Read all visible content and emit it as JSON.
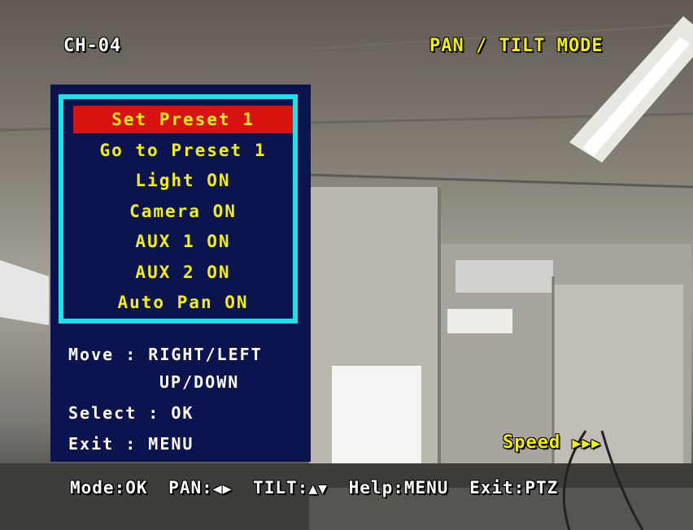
{
  "header": {
    "channel": "CH-04",
    "mode": "PAN / TILT MODE"
  },
  "menu": {
    "items": [
      {
        "label": "Set Preset 1",
        "selected": true
      },
      {
        "label": "Go to Preset 1",
        "selected": false
      },
      {
        "label": "Light ON",
        "selected": false
      },
      {
        "label": "Camera ON",
        "selected": false
      },
      {
        "label": "AUX 1 ON",
        "selected": false
      },
      {
        "label": "AUX 2 ON",
        "selected": false
      },
      {
        "label": "Auto Pan ON",
        "selected": false
      }
    ],
    "help": {
      "move": "Move : RIGHT/LEFT",
      "move2": "UP/DOWN",
      "select": "Select : OK",
      "exit": "Exit : MENU"
    }
  },
  "status": {
    "speed_label": "Speed",
    "speed_arrows": "▶▶▶"
  },
  "bottom_bar": {
    "mode": "Mode:OK",
    "pan": "PAN:",
    "pan_arrows": "◀▶",
    "tilt": "TILT:",
    "tilt_arrows": "▲▼",
    "help": "Help:MENU",
    "exit": "Exit:PTZ"
  },
  "colors": {
    "osd_yellow": "#f3f000",
    "menu_background": "#0c1450",
    "menu_border": "#19e4ea",
    "selected_background": "#d8120f"
  }
}
